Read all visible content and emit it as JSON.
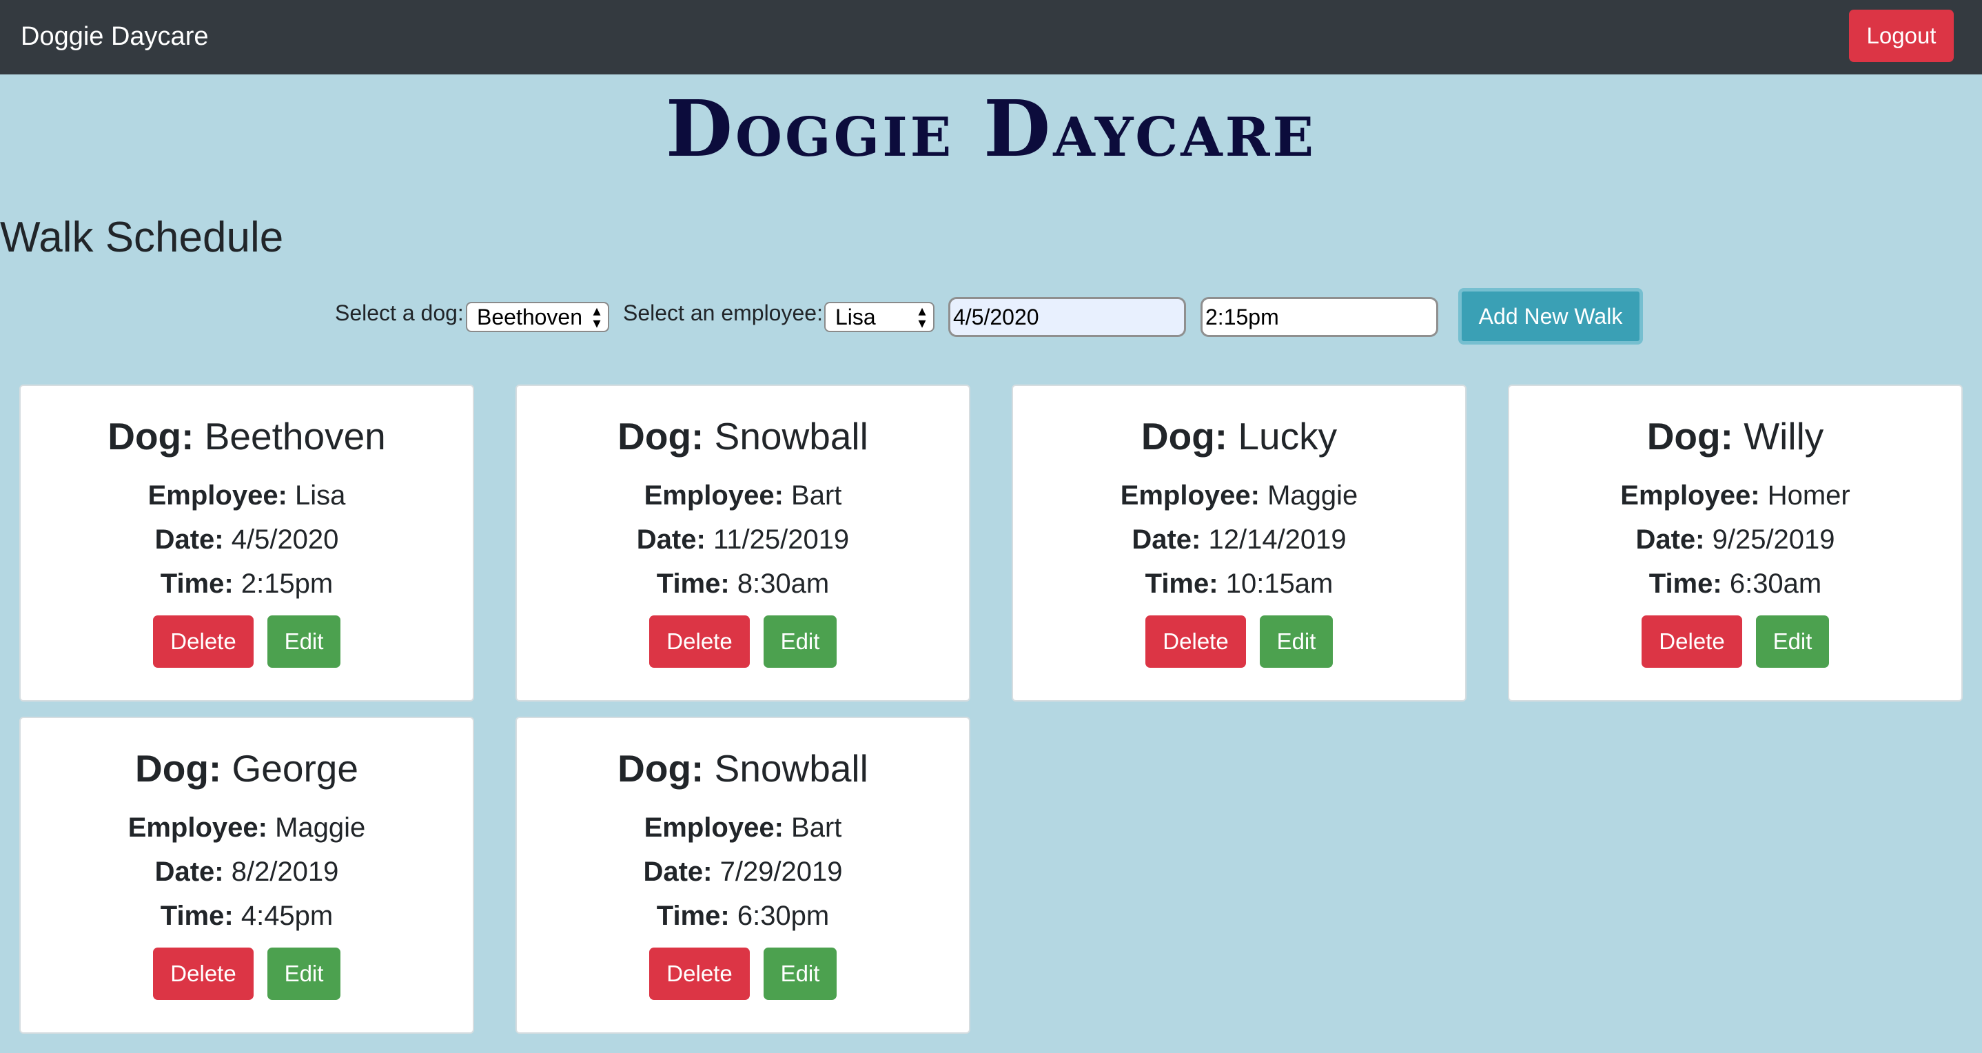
{
  "navbar": {
    "brand": "Doggie Daycare",
    "logout_label": "Logout",
    "colors": {
      "background": "#343a40",
      "logout": "#dc3545"
    }
  },
  "hero_title": "Doggie Daycare",
  "section_title": "Walk Schedule",
  "form": {
    "dog_label": "Select a dog:",
    "dog_selected": "Beethoven",
    "employee_label": "Select an employee:",
    "employee_selected": "Lisa",
    "date_value": "4/5/2020",
    "time_value": "2:15pm",
    "add_label": "Add New Walk",
    "colors": {
      "add_button": "#3aa0b5"
    }
  },
  "card_labels": {
    "dog": "Dog:",
    "employee": "Employee:",
    "date": "Date:",
    "time": "Time:",
    "delete": "Delete",
    "edit": "Edit"
  },
  "walks": [
    {
      "dog": "Beethoven",
      "employee": "Lisa",
      "date": "4/5/2020",
      "time": "2:15pm"
    },
    {
      "dog": "Snowball",
      "employee": "Bart",
      "date": "11/25/2019",
      "time": "8:30am"
    },
    {
      "dog": "Lucky",
      "employee": "Maggie",
      "date": "12/14/2019",
      "time": "10:15am"
    },
    {
      "dog": "Willy",
      "employee": "Homer",
      "date": "9/25/2019",
      "time": "6:30am"
    },
    {
      "dog": "George",
      "employee": "Maggie",
      "date": "8/2/2019",
      "time": "4:45pm"
    },
    {
      "dog": "Snowball",
      "employee": "Bart",
      "date": "7/29/2019",
      "time": "6:30pm"
    }
  ],
  "colors": {
    "page_background": "#b4d7e2",
    "delete_button": "#dc3545",
    "edit_button": "#4ca14f"
  }
}
